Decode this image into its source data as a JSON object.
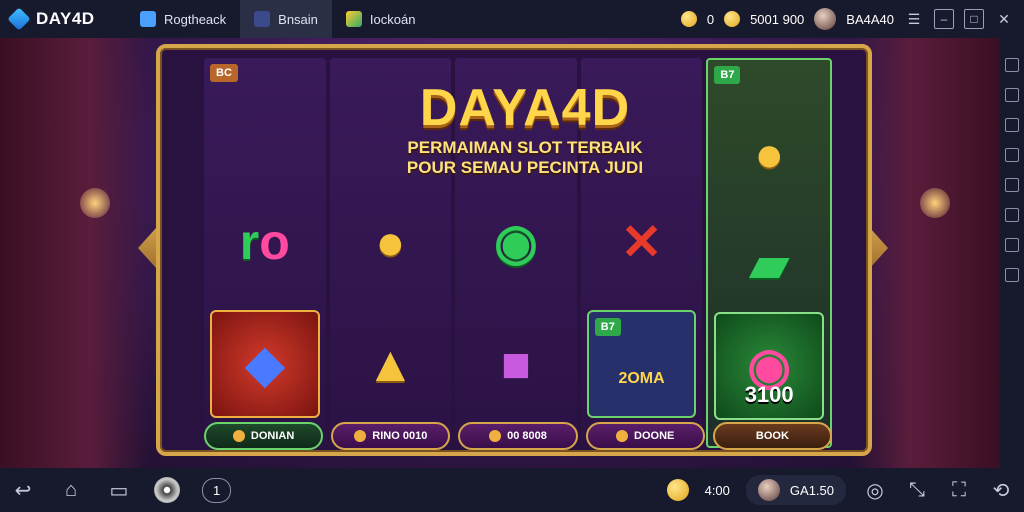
{
  "app": {
    "brand": "DAY4D"
  },
  "tabs": [
    {
      "label": "Rogtheack"
    },
    {
      "label": "Bnsain"
    },
    {
      "label": "Iockoán"
    }
  ],
  "top_status": {
    "coins": "0",
    "balance": "5001  900",
    "user": "BA4A40"
  },
  "game": {
    "title": "DAYA4D",
    "subtitle_line1": "PERMAIMAN SLOT TERBAIK",
    "subtitle_line2": "POUR SEMAU PECINTA JUDI"
  },
  "reels": [
    {
      "badge": "BC"
    },
    {
      "badge": ""
    },
    {
      "badge": ""
    },
    {
      "badge": ""
    },
    {
      "badge": "B7"
    }
  ],
  "cells": {
    "r4_bottom_badge": "B7",
    "r4_bottom_text": "2OMA",
    "r5_bottom_value": "3100"
  },
  "buttons": [
    {
      "label": "DONIAN"
    },
    {
      "label": "RINO 0010"
    },
    {
      "label": "00 8008"
    },
    {
      "label": "DOONE"
    },
    {
      "label": "BOOK"
    }
  ],
  "bottom": {
    "page": "1",
    "credits": "4:00",
    "profile": "GA1.50"
  },
  "colors": {
    "gold": "#d6a64a",
    "purple": "#3a1a52",
    "green": "#6bd36b",
    "bar": "#171a2c"
  }
}
